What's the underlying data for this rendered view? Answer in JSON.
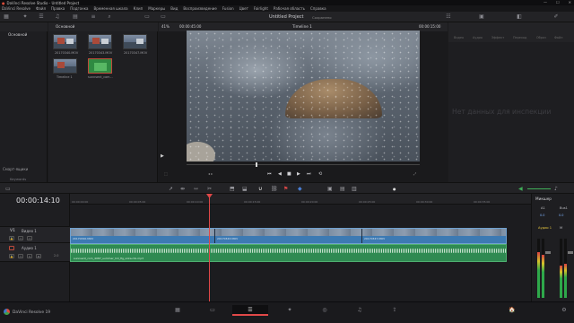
{
  "window": {
    "title": "DaVinci Resolve Studio - Untitled Project",
    "controls": [
      "—",
      "☐",
      "✕"
    ]
  },
  "menu": [
    "DaVinci Resolve",
    "Файл",
    "Правка",
    "Подгонка",
    "Временная шкала",
    "Клип",
    "Маркеры",
    "Вид",
    "Воспроизведение",
    "Fusion",
    "Цвет",
    "Fairlight",
    "Рабочая область",
    "Справка"
  ],
  "toolbar": {
    "project_title": "Untitled Project",
    "project_status": "Сохранено"
  },
  "left_panel": {
    "bin_label": "Основной",
    "smart_bins_label": "Смарт-ящики",
    "keywords_label": "Keywords"
  },
  "media_pool": {
    "name": "Основной",
    "clips": [
      {
        "name": "20170340.MOV"
      },
      {
        "name": "20170343.MOV"
      },
      {
        "name": "20170347.MOV"
      },
      {
        "name": "Timeline 1"
      },
      {
        "name": "sunnsent_com..."
      }
    ]
  },
  "viewer": {
    "zoom": "41%",
    "timecode_source": "00:00:45:00",
    "timeline_name": "Timeline 1",
    "timecode_duration": "00:00:15:00"
  },
  "inspector": {
    "tabs": [
      "Видео",
      "Аудио",
      "Эффект",
      "Переход",
      "Образ",
      "Файл"
    ],
    "empty_message": "Нет данных для инспекции"
  },
  "timeline": {
    "current_timecode": "00:00:14:10",
    "ruler": [
      "00:00:00:00",
      "00:00:05:00",
      "00:00:10:00",
      "00:00:15:00",
      "00:00:20:00",
      "00:00:25:00",
      "00:00:30:00",
      "00:00:35:00",
      "00:00:40:00"
    ],
    "video_track": {
      "code": "V1",
      "name": "Видео 1"
    },
    "audio_track": {
      "code": "A1",
      "name": "Аудио 1",
      "level": "2.0"
    },
    "video_clips": [
      "20170340.MOV",
      "20170343.MOV",
      "20170347.MOV"
    ],
    "audio_clip": "sunnsent_com_4087_summer_hill_fig_ukka.mb.mp3"
  },
  "mixer": {
    "title": "Микшер",
    "channels": [
      {
        "name": "A1",
        "value": "0.0"
      },
      {
        "name": "Bus1",
        "value": "0.0"
      }
    ],
    "track_labels": [
      "Аудио 1",
      "M"
    ],
    "meters": [
      0.78,
      0.72,
      0.55,
      0.58
    ]
  },
  "bottom": {
    "brand": "DaVinci Resolve 19",
    "pages": [
      "media",
      "cut",
      "edit",
      "fusion",
      "color",
      "fairlight",
      "deliver"
    ],
    "tray": [
      "🏠",
      "⚙"
    ]
  },
  "colors": {
    "accent": "#e04848",
    "video_clip": "#3d7ab3",
    "audio_clip": "#2f8a52",
    "panel": "#1e1e21"
  }
}
